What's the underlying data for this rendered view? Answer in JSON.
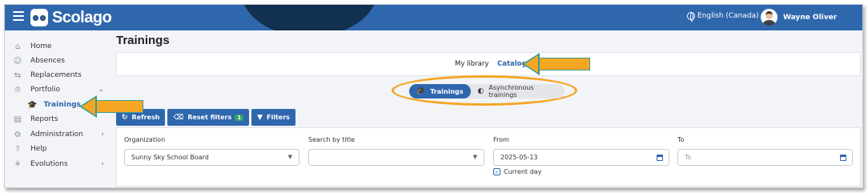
{
  "app": {
    "brand": "Scolago",
    "language": "English (Canada)",
    "user_name": "Wayne Oliver",
    "accent_color": "#2f67ad",
    "highlight_color": "#f5a623"
  },
  "sidebar": {
    "items": [
      {
        "label": "Home",
        "icon": "home-icon"
      },
      {
        "label": "Absences",
        "icon": "user-absence-icon"
      },
      {
        "label": "Replacements",
        "icon": "swap-icon"
      },
      {
        "label": "Portfolio",
        "icon": "trophy-icon",
        "chevron": "⌄"
      },
      {
        "label": "Trainings",
        "icon": "graduation-cap-icon",
        "active": true
      },
      {
        "label": "Reports",
        "icon": "report-icon"
      },
      {
        "label": "Administration",
        "icon": "gear-icon",
        "chevron": "›"
      },
      {
        "label": "Help",
        "icon": "question-icon"
      },
      {
        "label": "Evolutions",
        "icon": "sprout-icon",
        "chevron": "›"
      }
    ]
  },
  "main": {
    "title": "Trainings",
    "tabs": [
      {
        "label": "My library"
      },
      {
        "label": "Catalog",
        "active": true
      }
    ],
    "toggle": {
      "options": [
        {
          "label": "Trainings",
          "active": true
        },
        {
          "label": "Asynchronous trainings"
        }
      ]
    },
    "buttons": {
      "refresh": "Refresh",
      "reset": "Reset filters",
      "reset_badge": "1",
      "filters": "Filters"
    },
    "filters": {
      "organization_label": "Organization",
      "organization_value": "Sunny Sky School Board",
      "search_label": "Search by title",
      "search_value": "",
      "from_label": "From",
      "from_value": "2025-05-13",
      "to_label": "To",
      "to_placeholder": "To",
      "current_day_label": "Current day",
      "current_day_checked": true
    }
  }
}
